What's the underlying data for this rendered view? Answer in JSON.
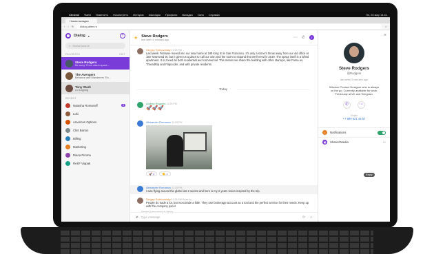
{
  "menubar": {
    "app": "Chrome",
    "items": [
      "Файл",
      "Изменить",
      "Посмотреть",
      "История",
      "Закладки",
      "Профили",
      "Вкладка",
      "Окно",
      "Справка"
    ],
    "clock": "Пн, 25 мар 14:41"
  },
  "browser": {
    "tab_title": "Новая вкладка",
    "url": "dialog.alien.ru"
  },
  "sidebar": {
    "title": "Dialog",
    "search_placeholder": "Global search",
    "favorites_label": "FAVORITES",
    "edit_label": "EDIT",
    "favorites": [
      {
        "name": "Steve Rodgers",
        "sub": "Be army. From vision space...",
        "active": true
      },
      {
        "name": "The Avengers",
        "sub": "Behance and Wanderers \"Ex...",
        "active": false
      },
      {
        "name": "Tony Stark",
        "sub": "••• is typing",
        "active": false,
        "selected": true
      }
    ],
    "recent_label": "RECENT",
    "recent": [
      {
        "name": "Natasha Romanoff",
        "badge": "3",
        "color": "#c0392b"
      },
      {
        "name": "Loki",
        "badge": "",
        "color": "#8e5a3c"
      },
      {
        "name": "American Options",
        "badge": "",
        "color": "#d35400"
      },
      {
        "name": "Clint Barton",
        "badge": "",
        "color": "#7f8c8d"
      },
      {
        "name": "Billing",
        "badge": "",
        "color": "#2980b9"
      },
      {
        "name": "Marketing",
        "badge": "",
        "color": "#e67e22"
      },
      {
        "name": "Diana Pimma",
        "badge": "",
        "color": "#8e44ad"
      },
      {
        "name": "ReSF Viapak",
        "badge": "",
        "color": "#16a085"
      }
    ]
  },
  "chat": {
    "title": "Steve Rodgers",
    "subtitle": "last seen 5 minutes ago",
    "messages": [
      {
        "author": "Sergey Sobrovolsky",
        "time": "12:25 PM",
        "text": "Last week Firebase moved into our new home at 188 King St in San Francisco. It's only a stone's throw away from our old office at 150 Townsend St, but it gives us a place to call our own and the room to expand that we'll need in 2019. The space itself is a lofted apartment. It is zoned as both residential and commercial. This means we share the building with other startups, like Fama.us, ThreadRip and Flapcoder, and with private residents."
      },
      {
        "author": "Andrey Rogozin",
        "time": "12:25 PM",
        "text": "🚀🚀🚀"
      },
      {
        "author": "Alexander Romanov",
        "time": "12:25 PM",
        "text": ""
      },
      {
        "author": "Alexander Romanov",
        "time": "12:25 PM",
        "text": "I was flying around the globe last 2 weeks and here is my 2 years vision inspired by the trip."
      },
      {
        "author": "Sergey Sobrovolsky",
        "time": "12:25 PM",
        "seen": "Read by",
        "text": "People do trade a lot, but most trade a little. They use brokerage account as a tool and the perfect service for their needs. Keep up with the company pace!"
      }
    ],
    "divider": "Today",
    "reactions": [
      {
        "emoji": "🚀",
        "count": "2"
      },
      {
        "emoji": "👏",
        "count": "1"
      }
    ],
    "reply_tooltip": "Reply",
    "typing": "Sergei Sobrovolsky is typing",
    "composer_placeholder": "Type message"
  },
  "profile": {
    "name": "Steve Rodgers",
    "username": "@Rodgers",
    "seen": "last seen 5 minutes ago",
    "bio": "Wisdom Product Designer who is always on the go. Currently available for work. Previously at VK and Telegram.",
    "mobile_label": "Mobile",
    "phone": "+7 999 621 48 57",
    "notifications_label": "Notifications",
    "shared_label": "Shared Media",
    "shared_count": "12"
  },
  "colors": {
    "accent": "#7a3cd8",
    "link": "#3a7bd5",
    "toggle": "#2ea46c"
  }
}
